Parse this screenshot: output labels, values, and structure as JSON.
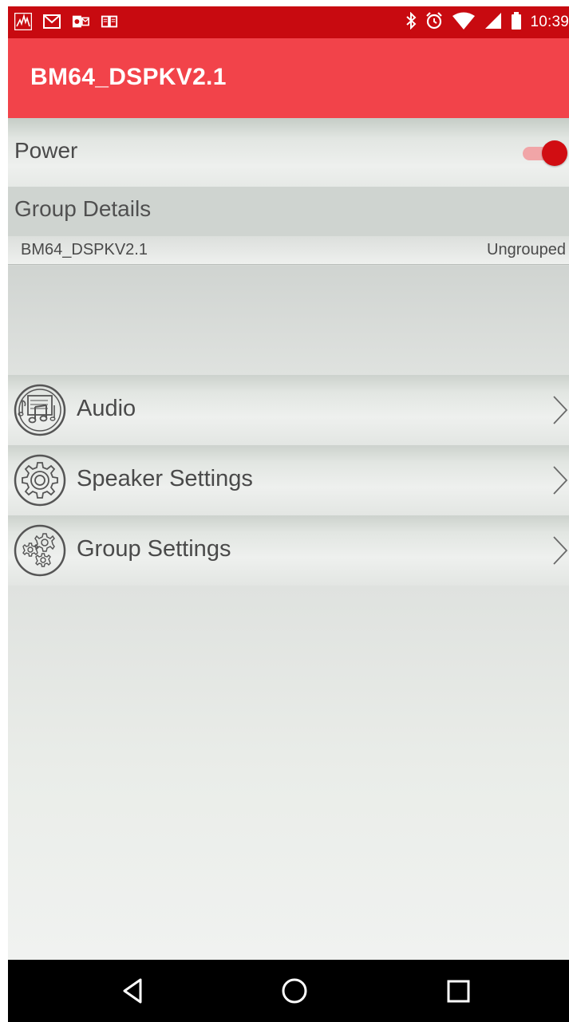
{
  "status_bar": {
    "time": "10:39",
    "left_icons": [
      "sound-meter-icon",
      "gmail-icon",
      "outlook-icon",
      "book-icon"
    ],
    "right_icons": [
      "bluetooth-icon",
      "alarm-icon",
      "wifi-icon",
      "signal-icon",
      "battery-icon"
    ],
    "color": "#c80a10"
  },
  "app_bar": {
    "title": "BM64_DSPKV2.1",
    "color": "#f2434a"
  },
  "power": {
    "label": "Power",
    "enabled": true,
    "accent": "#d10d12"
  },
  "group_details": {
    "header": "Group Details",
    "rows": [
      {
        "name": "BM64_DSPKV2.1",
        "status": "Ungrouped"
      }
    ]
  },
  "menu": [
    {
      "label": "Audio",
      "icon": "audio-music-note-icon"
    },
    {
      "label": "Speaker Settings",
      "icon": "speaker-settings-gear-icon"
    },
    {
      "label": "Group Settings",
      "icon": "group-settings-gears-icon"
    }
  ],
  "nav_bar": {
    "buttons": [
      "back-icon",
      "home-icon",
      "recent-apps-icon"
    ]
  }
}
